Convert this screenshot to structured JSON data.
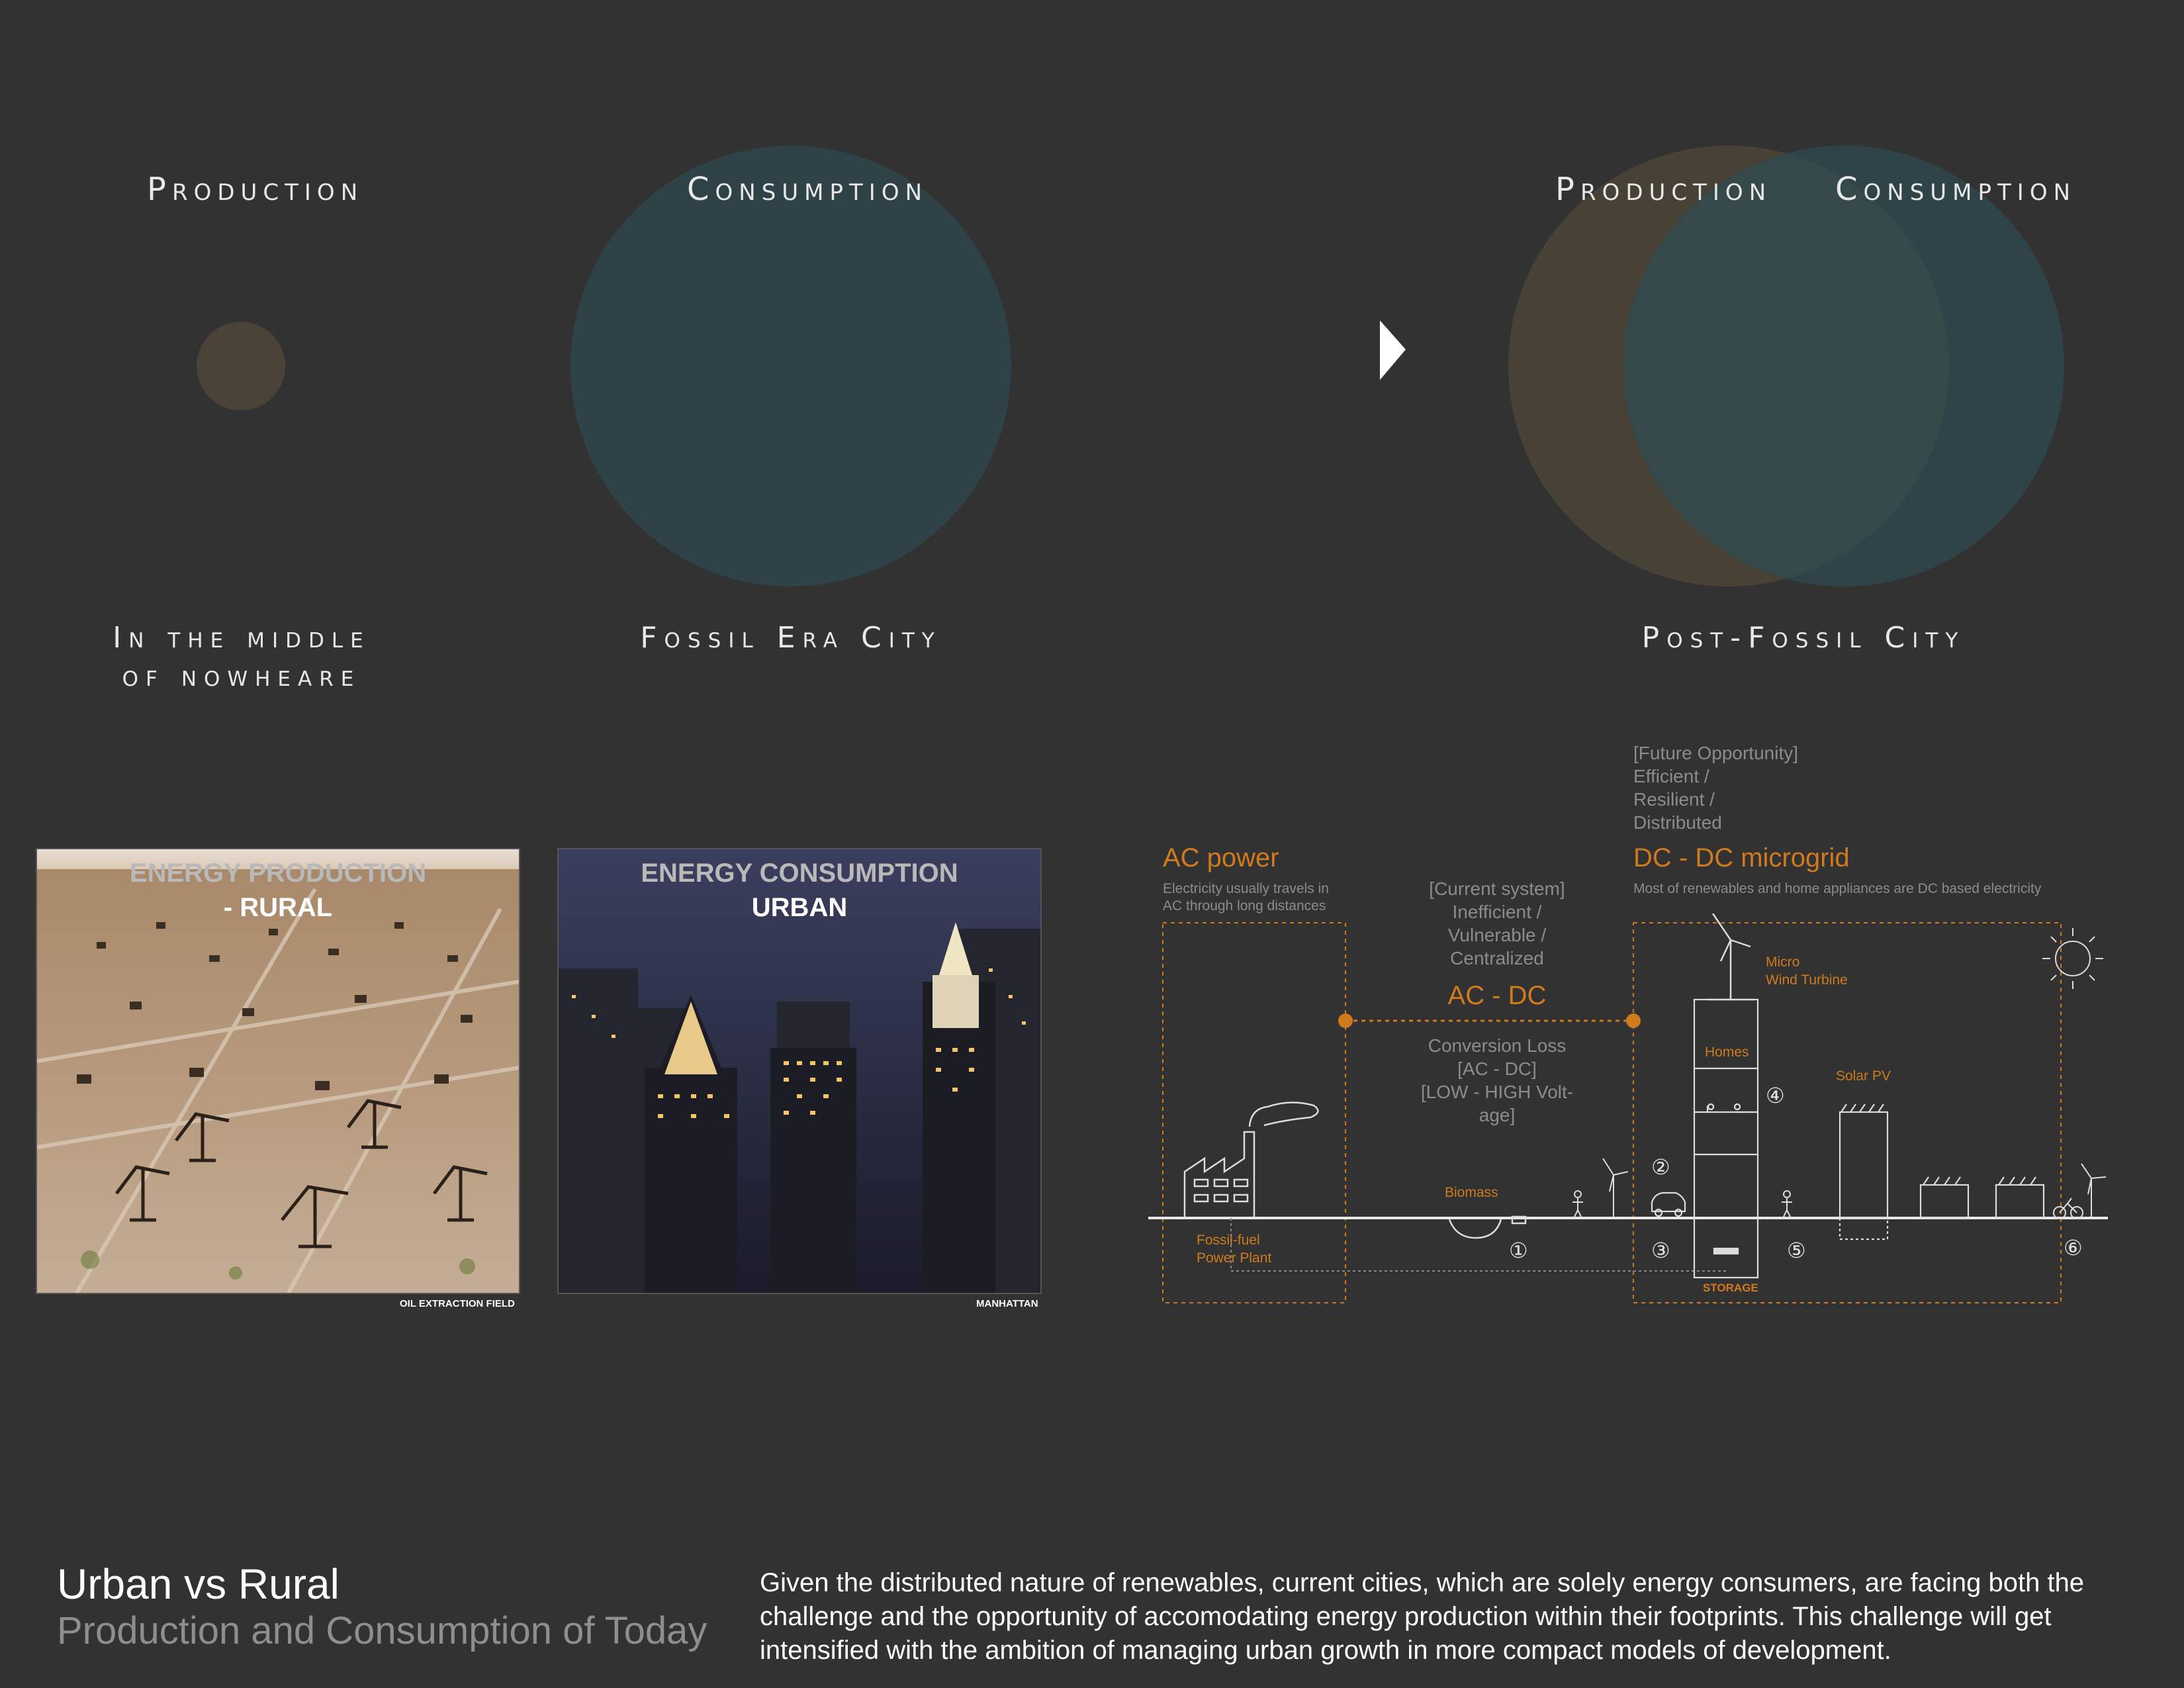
{
  "venn": {
    "left_production": "Production",
    "left_consumption": "Consumption",
    "right_production": "Production",
    "right_consumption": "Consumption",
    "label_nowhere_1": "In the middle",
    "label_nowhere_2": "of nowheare",
    "label_fossil": "Fossil Era City",
    "label_postfossil": "Post-Fossil City"
  },
  "photos": {
    "rural": {
      "title": "ENERGY PRODUCTION",
      "subtitle": "- RURAL",
      "caption": "OIL EXTRACTION FIELD"
    },
    "urban": {
      "title": "ENERGY CONSUMPTION",
      "subtitle": "URBAN",
      "caption": "MANHATTAN"
    }
  },
  "grid": {
    "ac_title": "AC power",
    "ac_desc_1": "Electricity usually travels in",
    "ac_desc_2": "AC through long distances",
    "current_1": "[Current system]",
    "current_2": "Inefficient /",
    "current_3": "Vulnerable /",
    "current_4": "Centralized",
    "acdc_title": "AC - DC",
    "loss_1": "Conversion Loss",
    "loss_2": "[AC - DC]",
    "loss_3": "[LOW - HIGH Volt-",
    "loss_4": "age]",
    "future_1": "[Future Opportunity]",
    "future_2": "Efficient /",
    "future_3": "Resilient /",
    "future_4": "Distributed",
    "dc_title": "DC - DC microgrid",
    "dc_desc": "Most of renewables and home appliances are DC based electricity",
    "micro_1": "Micro",
    "micro_2": "Wind Turbine",
    "homes": "Homes",
    "solar": "Solar PV",
    "biomass": "Biomass",
    "fossil_1": "Fossil-fuel",
    "fossil_2": "Power Plant",
    "storage": "STORAGE",
    "n1": "①",
    "n2": "②",
    "n3": "③",
    "n4": "④",
    "n5": "⑤",
    "n6": "⑥"
  },
  "footer": {
    "title": "Urban vs Rural",
    "subtitle": "Production and Consumption of Today",
    "body": "Given the distributed nature of renewables, current cities, which are solely energy consumers, are facing both the challenge and the opportunity of accomodating energy production within their footprints. This challenge will get intensified with the ambition of managing urban growth in more compact models of development."
  },
  "colors": {
    "background": "#323232",
    "production": "#4a4237",
    "consumption": "#2e4247",
    "accent": "#d07a1e"
  }
}
